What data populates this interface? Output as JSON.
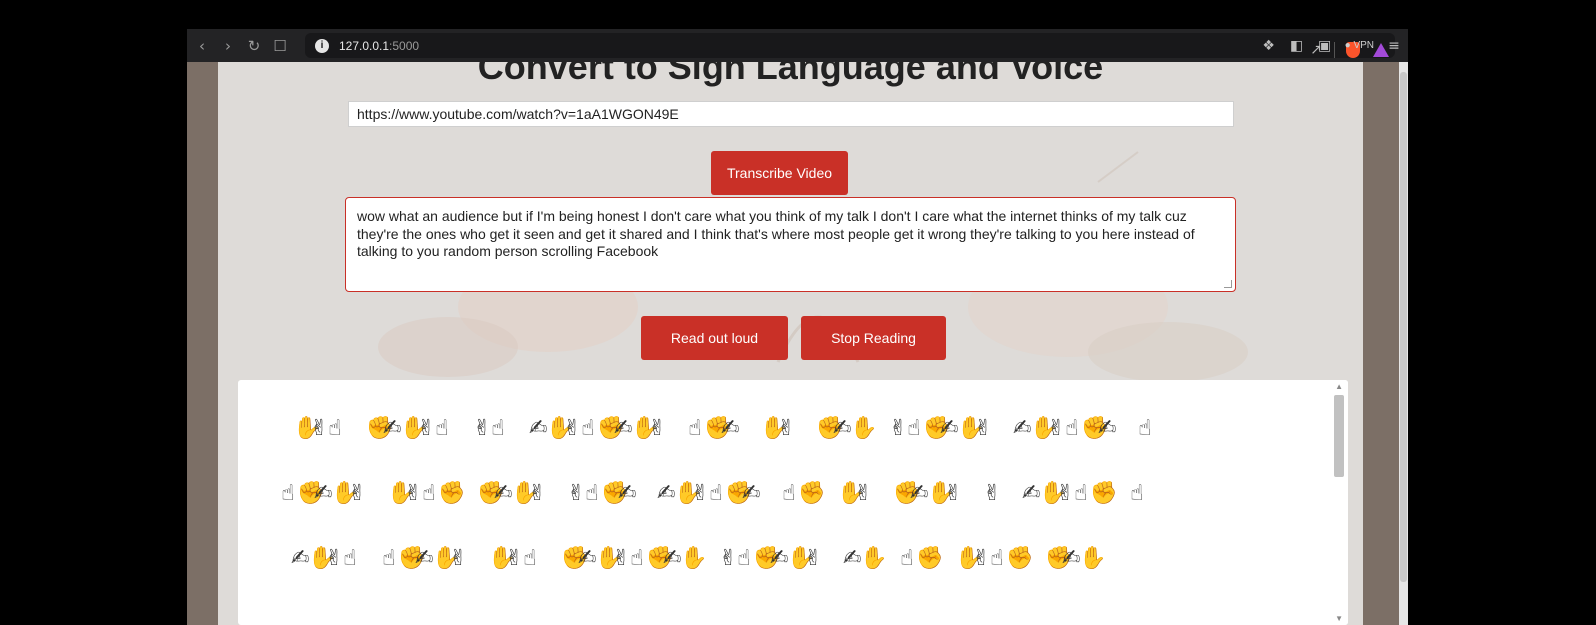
{
  "browser": {
    "url_host": "127.0.0.1",
    "url_port": ":5000",
    "vpn_label": "VPN",
    "nav_icons": [
      "back-icon",
      "forward-icon",
      "reload-icon",
      "bookmark-icon"
    ],
    "right_icons": [
      "share-icon",
      "brave-shields-icon",
      "brave-rewards-icon",
      "extensions-icon",
      "sidebar-icon",
      "wallet-icon",
      "vpn-icon",
      "menu-icon"
    ]
  },
  "page": {
    "title": "Convert to Sign Language and Voice",
    "url_input_value": "https://www.youtube.com/watch?v=1aA1WGON49E",
    "transcribe_label": "Transcribe Video",
    "transcript_text": "wow what an audience but if I'm being honest I don't care what you think of my talk I don't I care what the internet thinks of my talk cuz they're the ones who get it seen and get it shared and I think that's where most people get it wrong they're talking to you here instead of talking to you random person scrolling Facebook",
    "read_label": "Read out loud",
    "stop_label": "Stop Reading"
  },
  "sign_panel": {
    "rows": [
      {
        "words": [
          {
            "letters": 3
          },
          {
            "letters": 5
          },
          {
            "letters": 2
          },
          {
            "letters": 8
          },
          {
            "letters": 3
          },
          {
            "letters": 2
          },
          {
            "letters": 3
          },
          {
            "letters": 6
          },
          {
            "letters": 6
          },
          {
            "letters": 1
          }
        ]
      },
      {
        "words": [
          {
            "letters": 5
          },
          {
            "letters": 4
          },
          {
            "letters": 4
          },
          {
            "letters": 4
          },
          {
            "letters": 6
          },
          {
            "letters": 2
          },
          {
            "letters": 2
          },
          {
            "letters": 4
          },
          {
            "letters": 1
          },
          {
            "letters": 5
          },
          {
            "letters": 1
          }
        ]
      },
      {
        "words": [
          {
            "letters": 4
          },
          {
            "letters": 5
          },
          {
            "letters": 3
          },
          {
            "letters": 8
          },
          {
            "letters": 6
          },
          {
            "letters": 2
          },
          {
            "letters": 2
          },
          {
            "letters": 4
          },
          {
            "letters": 3
          }
        ]
      }
    ]
  },
  "colors": {
    "accent_red": "#c93027",
    "page_bg": "#dedbd8",
    "browser_bg": "#232325"
  }
}
